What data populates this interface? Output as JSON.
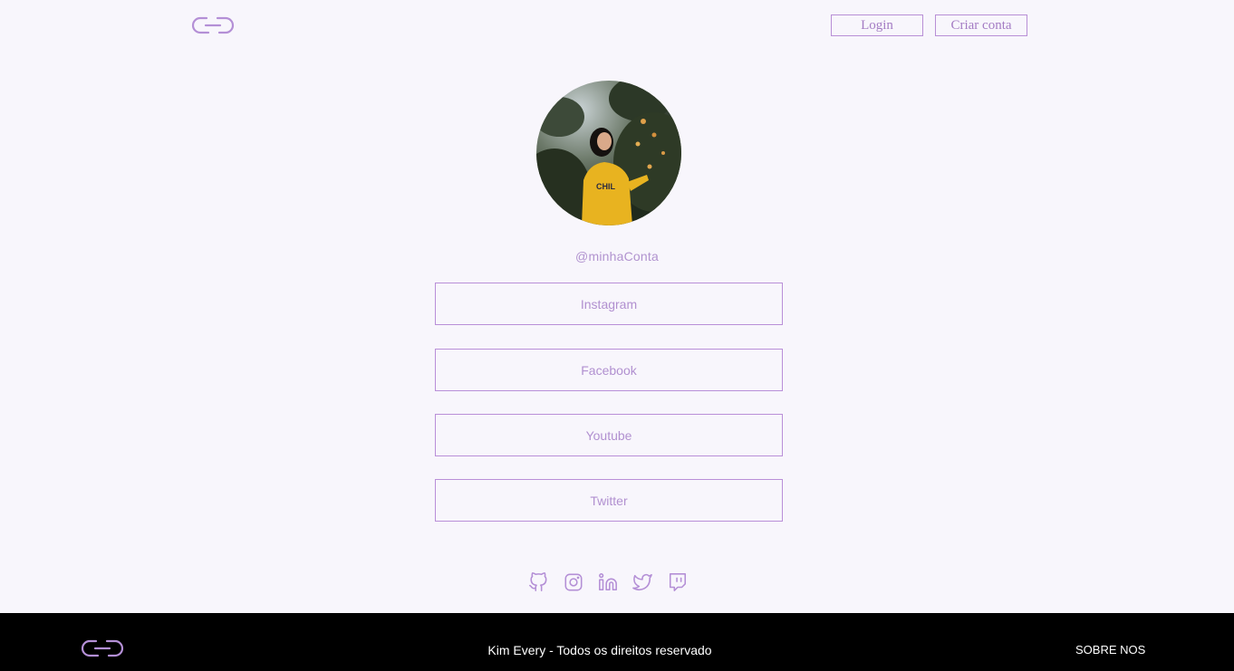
{
  "header": {
    "logo_icon": "chain-link-logo-icon",
    "login_label": "Login",
    "signup_label": "Criar conta"
  },
  "profile": {
    "avatar": "profile-photo-woman-yellow-sweater",
    "handle": "@minhaConta"
  },
  "links": [
    {
      "label": "Instagram"
    },
    {
      "label": "Facebook"
    },
    {
      "label": "Youtube"
    },
    {
      "label": "Twitter"
    }
  ],
  "social_icons": [
    "github-icon",
    "instagram-icon",
    "linkedin-icon",
    "twitter-icon",
    "twitch-icon"
  ],
  "footer": {
    "logo_icon": "chain-link-logo-icon",
    "copyright": "Kim Every - Todos os direitos reservado",
    "about_label": "SOBRE NOS"
  },
  "colors": {
    "background": "#f8f6fc",
    "accent": "#b98fd8",
    "footer_bg": "#000000"
  }
}
